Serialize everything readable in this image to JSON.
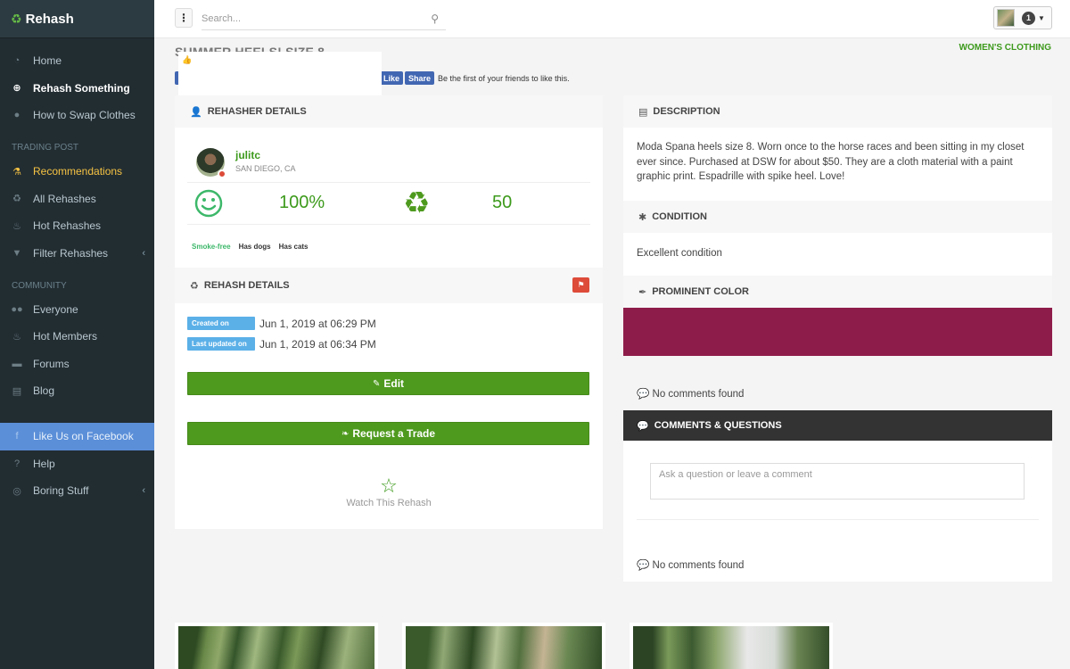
{
  "app": {
    "name": "Rehash"
  },
  "sidebar": {
    "items_top": [
      {
        "label": "Home",
        "icon": "dashboard-icon"
      },
      {
        "label": "Rehash Something",
        "icon": "plus-circle-icon"
      },
      {
        "label": "How to Swap Clothes",
        "icon": "info-circle-icon"
      }
    ],
    "trading_header": "TRADING POST",
    "trading_items": [
      {
        "label": "Recommendations",
        "icon": "flask-icon"
      },
      {
        "label": "All Rehashes",
        "icon": "recycle-icon"
      },
      {
        "label": "Hot Rehashes",
        "icon": "fire-icon"
      },
      {
        "label": "Filter Rehashes",
        "icon": "filter-icon"
      }
    ],
    "community_header": "COMMUNITY",
    "community_items": [
      {
        "label": "Everyone",
        "icon": "users-icon"
      },
      {
        "label": "Hot Members",
        "icon": "fire-icon"
      },
      {
        "label": "Forums",
        "icon": "comments-icon"
      },
      {
        "label": "Blog",
        "icon": "newspaper-icon"
      }
    ],
    "bottom_items": [
      {
        "label": "Like Us on Facebook",
        "icon": "facebook-icon"
      },
      {
        "label": "Help",
        "icon": "question-icon"
      },
      {
        "label": "Boring Stuff",
        "icon": "circle-icon"
      }
    ]
  },
  "topbar": {
    "search_placeholder": "Search...",
    "notification_count": "1"
  },
  "listing": {
    "title": "SUMMER HEELS! SIZE 8",
    "category": "WOMEN'S CLOTHING",
    "fb_like": "Like",
    "fb_share": "Share",
    "fb_text": "Be the first of your friends to like this."
  },
  "rehasher": {
    "heading": "REHASHER DETAILS",
    "username": "julitc",
    "location": "SAN DIEGO, CA",
    "rating": "100%",
    "trades": "50",
    "tags": [
      "Smoke-free",
      "Has dogs",
      "Has cats"
    ]
  },
  "details": {
    "heading": "REHASH DETAILS",
    "created_label": "Created on",
    "created_value": "Jun 1, 2019 at 06:29 PM",
    "updated_label": "Last updated on",
    "updated_value": "Jun 1, 2019 at 06:34 PM",
    "edit_label": "Edit",
    "trade_label": "Request a Trade",
    "watch_label": "Watch This Rehash"
  },
  "description": {
    "heading": "DESCRIPTION",
    "text": "Moda Spana heels size 8. Worn once to the horse races and been sitting in my closet ever since. Purchased at DSW for about $50. They are a cloth material with a paint graphic print. Espadrille with spike heel. Love!"
  },
  "condition": {
    "heading": "CONDITION",
    "text": "Excellent condition"
  },
  "color": {
    "heading": "PROMINENT COLOR",
    "swatch": "#8e1c4a"
  },
  "comments": {
    "no_comments_top": "No comments found",
    "heading": "COMMENTS & QUESTIONS",
    "placeholder": "Ask a question or leave a comment",
    "no_comments_bottom": "No comments found"
  },
  "colors": {
    "sidebar_bg": "#222d32",
    "accent_green": "#4e9a1e",
    "facebook_blue": "#5b8fd8",
    "highlight_yellow": "#f6c343"
  }
}
